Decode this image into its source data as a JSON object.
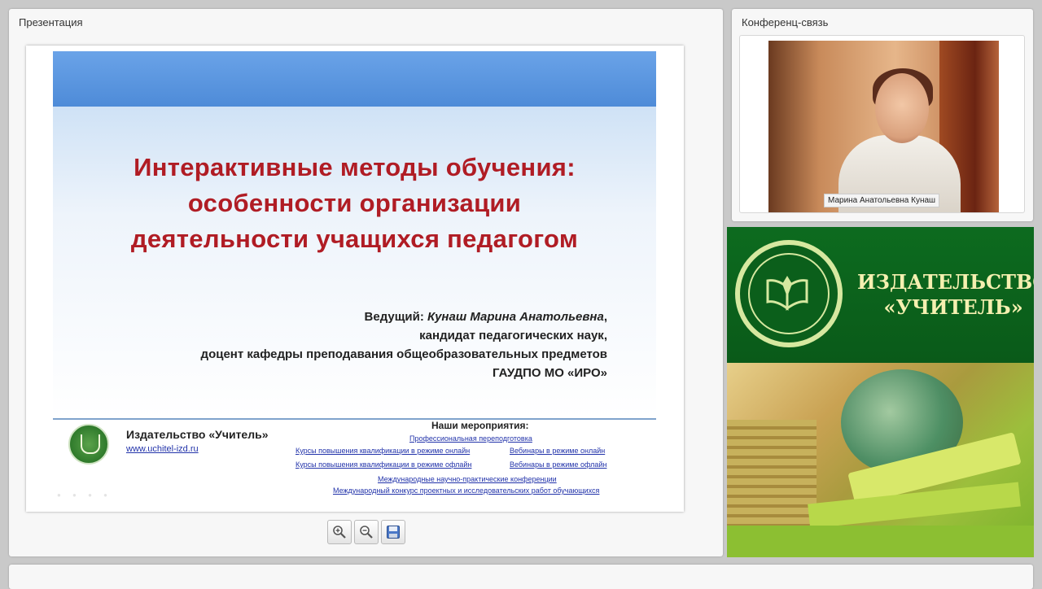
{
  "presentation_panel": {
    "title": "Презентация",
    "slide": {
      "title_lines": [
        "Интерактивные методы обучения:",
        "особенности организации",
        "деятельности учащихся педагогом"
      ],
      "presenter_label": "Ведущий:",
      "presenter_name": "Кунаш Марина Анатольевна",
      "presenter_suffix": ",",
      "presenter_lines": [
        "кандидат педагогических наук,",
        "доцент кафедры преподавания общеобразовательных предметов",
        "ГАУДПО МО «ИРО»"
      ],
      "footer": {
        "publisher_name": "Издательство «Учитель»",
        "publisher_url": "www.uchitel-izd.ru",
        "events_heading": "Наши мероприятия:",
        "events": [
          "Профессиональная переподготовка",
          "Курсы повышения квалификации в режиме онлайн",
          "Вебинары в режиме онлайн",
          "Курсы повышения квалификации в режиме офлайн",
          "Вебинары в режиме офлайн",
          "Международные научно-практические конференции",
          "Международный конкурс проектных и исследовательских работ обучающихся"
        ]
      }
    },
    "toolbar": [
      {
        "icon": "zoom-in-icon"
      },
      {
        "icon": "zoom-out-icon"
      },
      {
        "icon": "save-icon"
      }
    ]
  },
  "conference_panel": {
    "title": "Конференц-связь",
    "speaker_name": "Марина Анатольевна Кунаш"
  },
  "banner": {
    "line1": "ИЗДАТЕЛЬСТВО",
    "line2": "«УЧИТЕЛЬ»"
  },
  "colors": {
    "slide_title": "#b01c24",
    "link": "#2233aa",
    "banner_green": "#0d6b1f",
    "banner_text": "#f5f0b0"
  }
}
